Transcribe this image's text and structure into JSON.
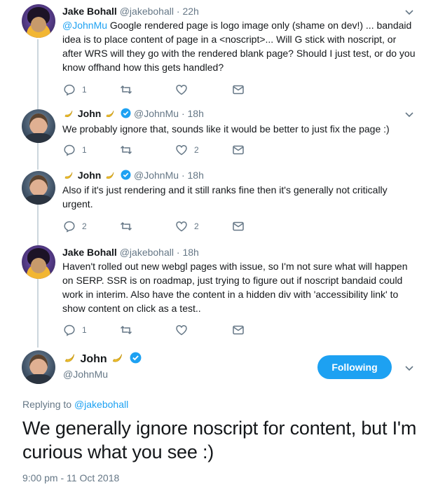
{
  "tweets": [
    {
      "name": "Jake Bohall",
      "handle": "@jakebohall",
      "dot": "·",
      "time": "22h",
      "mention": "@JohnMu",
      "text": "  Google rendered page is logo image only (shame on dev!) ... bandaid idea is to place content of page in a <noscript>...  Will G stick with noscript, or after WRS will they go with the rendered blank page? Should I just test, or do you know offhand how this gets handled?",
      "replies": "1",
      "likes": ""
    },
    {
      "name": "John",
      "handle": "@JohnMu",
      "dot": "·",
      "time": "18h",
      "text": "We probably ignore that, sounds like it would be better to just fix the page :)",
      "replies": "1",
      "likes": "2"
    },
    {
      "name": "John",
      "handle": "@JohnMu",
      "dot": "·",
      "time": "18h",
      "text": "Also if it's just rendering and it still ranks fine then it's generally not critically urgent.",
      "replies": "2",
      "likes": "2"
    },
    {
      "name": "Jake Bohall",
      "handle": "@jakebohall",
      "dot": "·",
      "time": "18h",
      "text": "Haven't rolled out new webgl pages with issue, so I'm not sure what will happen on SERP.  SSR is on roadmap, just trying to figure out if noscript bandaid could work in interim.  Also have the content in a hidden div with 'accessibility link' to show content on click as a test..",
      "replies": "1",
      "likes": ""
    }
  ],
  "main": {
    "name": "John",
    "handle": "@JohnMu",
    "follow_label": "Following",
    "replying_prefix": "Replying to ",
    "replying_handle": "@jakebohall",
    "text": "We generally ignore noscript for content, but I'm curious what you see :)",
    "timestamp": "9:00 pm - 11 Oct 2018"
  },
  "icons": [
    "reply-icon",
    "retweet-icon",
    "like-icon",
    "dm-icon",
    "chevron-down-icon",
    "verified-icon",
    "banana-icon"
  ],
  "colors": {
    "accent": "#1da1f2",
    "muted": "#657786",
    "text": "#14171a",
    "line": "#ccd6dd"
  }
}
